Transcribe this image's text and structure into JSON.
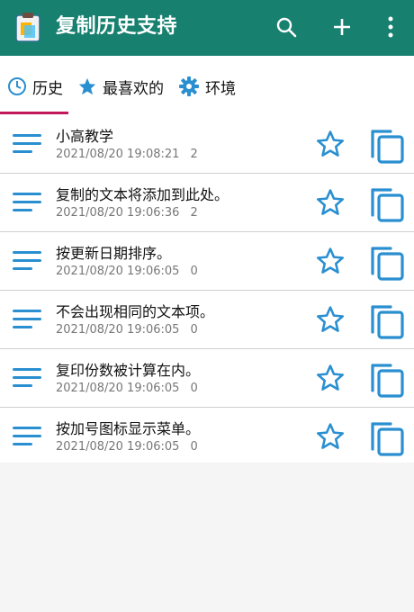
{
  "app": {
    "title": "复制历史支持",
    "icon": "clipboard-icon",
    "actions": [
      {
        "name": "search-icon"
      },
      {
        "name": "add-icon"
      },
      {
        "name": "more-vert-icon"
      }
    ],
    "colors": {
      "appbar": "#17806f",
      "accent": "#2a8fd0",
      "indicator": "#c2185b"
    }
  },
  "tabs": [
    {
      "label": "历史",
      "icon": "clock-icon",
      "active": true
    },
    {
      "label": "最喜欢的",
      "icon": "star-filled-icon",
      "active": false
    },
    {
      "label": "环境",
      "icon": "gear-icon",
      "active": false
    }
  ],
  "items": [
    {
      "title": "小高教学",
      "time": "2021/08/20 19:08:21",
      "count": "2"
    },
    {
      "title": "复制的文本将添加到此处。",
      "time": "2021/08/20 19:06:36",
      "count": "2"
    },
    {
      "title": "按更新日期排序。",
      "time": "2021/08/20 19:06:05",
      "count": "0"
    },
    {
      "title": "不会出现相同的文本项。",
      "time": "2021/08/20 19:06:05",
      "count": "0"
    },
    {
      "title": "复印份数被计算在内。",
      "time": "2021/08/20 19:06:05",
      "count": "0"
    },
    {
      "title": "按加号图标显示菜单。",
      "time": "2021/08/20 19:06:05",
      "count": "0"
    }
  ]
}
